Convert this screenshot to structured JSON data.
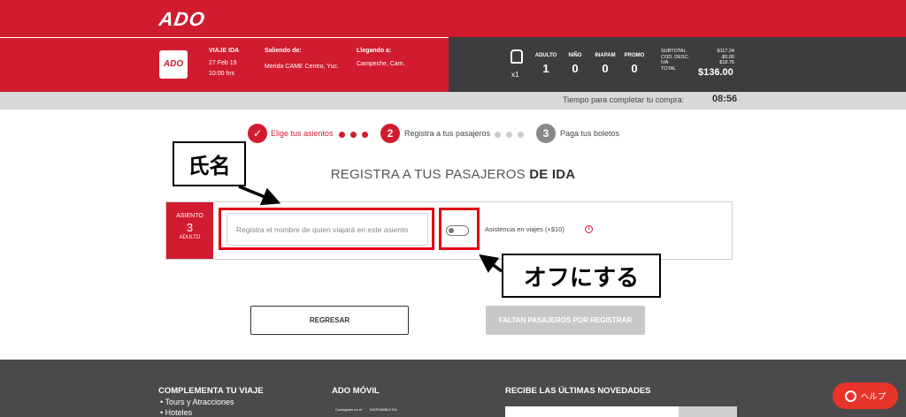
{
  "header": {
    "logo": "ADO"
  },
  "trip": {
    "badge": "ADO",
    "type": "VIAJE IDA",
    "date": "27 Feb 19",
    "time": "10:00 hrs",
    "departure_label": "Saliendo de:",
    "departure_value": "Merida CAME Centro, Yuc.",
    "arrival_label": "Llegando a:",
    "arrival_value": "Campeche, Cam."
  },
  "passengers": {
    "seat_count": "x1",
    "columns": [
      {
        "label": "ADULTO",
        "value": "1"
      },
      {
        "label": "NIÑO",
        "value": "0"
      },
      {
        "label": "INAPAM",
        "value": "0"
      },
      {
        "label": "PROMO",
        "value": "0"
      }
    ]
  },
  "totals": {
    "subtotal_label": "SUBTOTAL",
    "subtotal_value": "$117.24",
    "discount_label": "COD. DESC.",
    "discount_value": "-$0.00",
    "iva_label": "IVA",
    "iva_value": "$18.76",
    "total_label": "TOTAL",
    "total_value": "$136.00"
  },
  "timer": {
    "label": "Tiempo para completar tu compra:",
    "value": "08:56"
  },
  "steps": [
    {
      "number": "✓",
      "label": "Elige tus asientos"
    },
    {
      "number": "2",
      "label": "Registra a tus pasajeros"
    },
    {
      "number": "3",
      "label": "Paga tus boletos"
    }
  ],
  "form": {
    "title_regular": "REGISTRA A TUS PASAJEROS",
    "title_bold": "DE IDA",
    "seat_label": "ASIENTO",
    "seat_number": "3",
    "seat_type": "ADULTO",
    "name_placeholder": "Registra el nombre de quien viajará en este asiento",
    "name_value": "",
    "assist_label": "Asistencia en viajes (+$10)",
    "assist_on": false,
    "info_glyph": "i"
  },
  "annotations": {
    "name_callout": "氏名",
    "toggle_callout": "オフにする",
    "highlight_color": "#e30613"
  },
  "buttons": {
    "back": "REGRESAR",
    "next": "FALTAN PASAJEROS POR REGISTRAR"
  },
  "footer": {
    "complement_heading": "COMPLEMENTA TU VIAJE",
    "links": [
      "Tours y Atracciones",
      "Hoteles"
    ],
    "mobile_heading": "ADO MÓVIL",
    "app_store_text": "Consíguelo en el",
    "play_store_text": "DISPONIBLE EN",
    "newsletter_heading": "RECIBE LAS ÚLTIMAS NOVEDADES",
    "help_label": "ヘルプ"
  },
  "colors": {
    "brand_red": "#d01c2e",
    "dark_panel": "#3d3d3f",
    "footer_bg": "#4a4a4c",
    "help_red": "#e8332a"
  }
}
